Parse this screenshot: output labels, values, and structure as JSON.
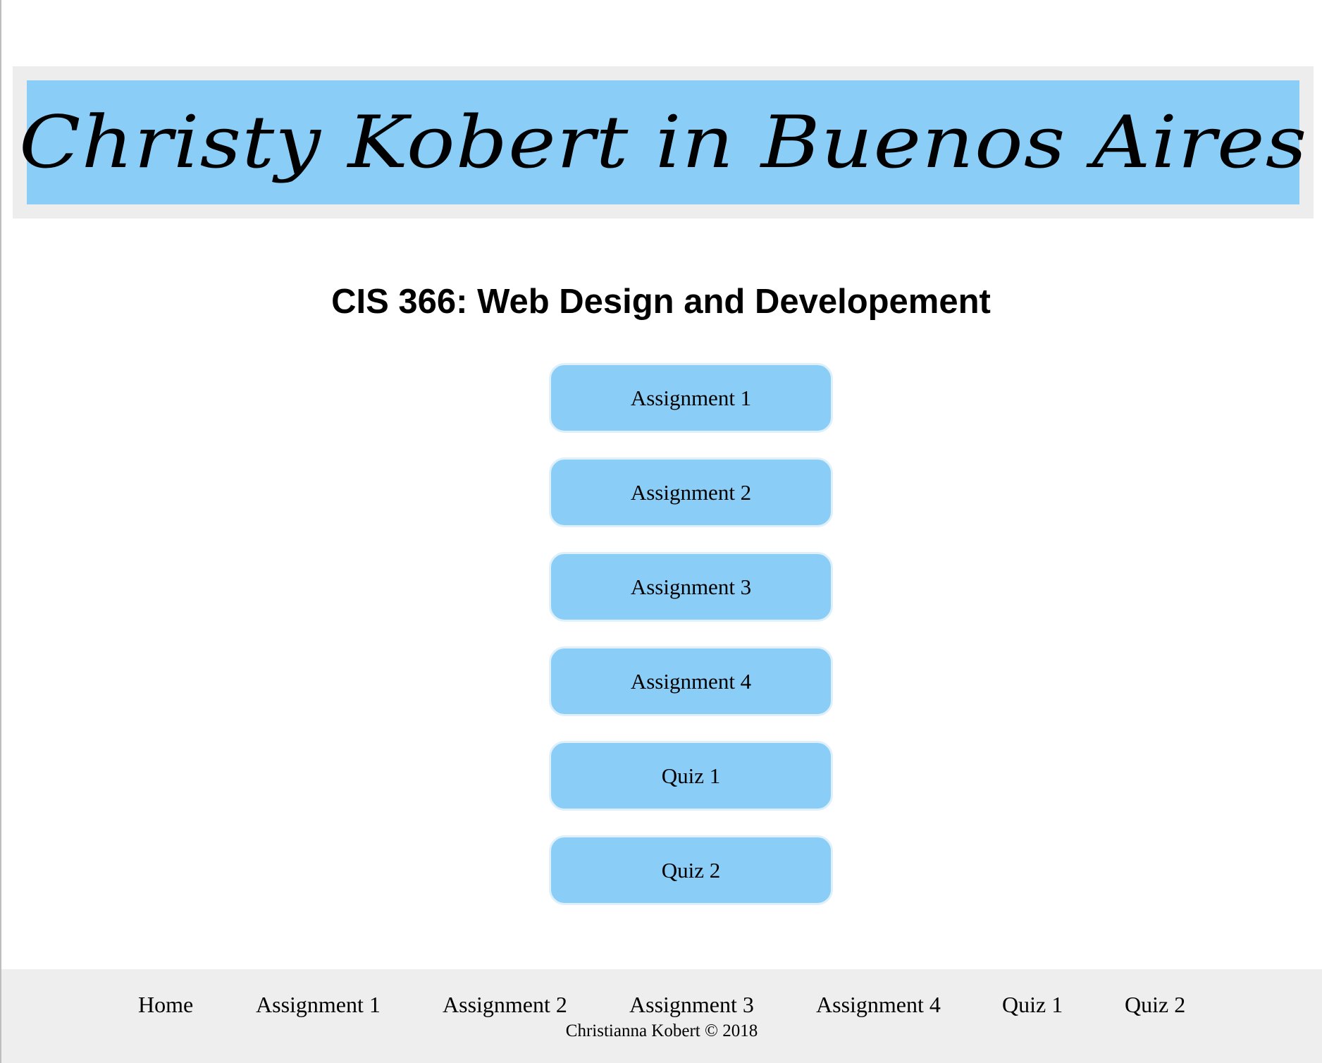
{
  "header": {
    "banner_title": "Christy Kobert in Buenos Aires"
  },
  "main": {
    "heading": "CIS 366: Web Design and Developement",
    "buttons": [
      {
        "label": "Assignment 1"
      },
      {
        "label": "Assignment 2"
      },
      {
        "label": "Assignment 3"
      },
      {
        "label": "Assignment 4"
      },
      {
        "label": "Quiz 1"
      },
      {
        "label": "Quiz 2"
      }
    ]
  },
  "footer": {
    "nav": [
      {
        "label": "Home"
      },
      {
        "label": "Assignment 1"
      },
      {
        "label": "Assignment 2"
      },
      {
        "label": "Assignment 3"
      },
      {
        "label": "Assignment 4"
      },
      {
        "label": "Quiz 1"
      },
      {
        "label": "Quiz 2"
      }
    ],
    "copyright": "Christianna Kobert © 2018"
  },
  "colors": {
    "banner_blue": "#8acdf6",
    "banner_frame": "#ededed",
    "footer_bg": "#eeeeee"
  }
}
